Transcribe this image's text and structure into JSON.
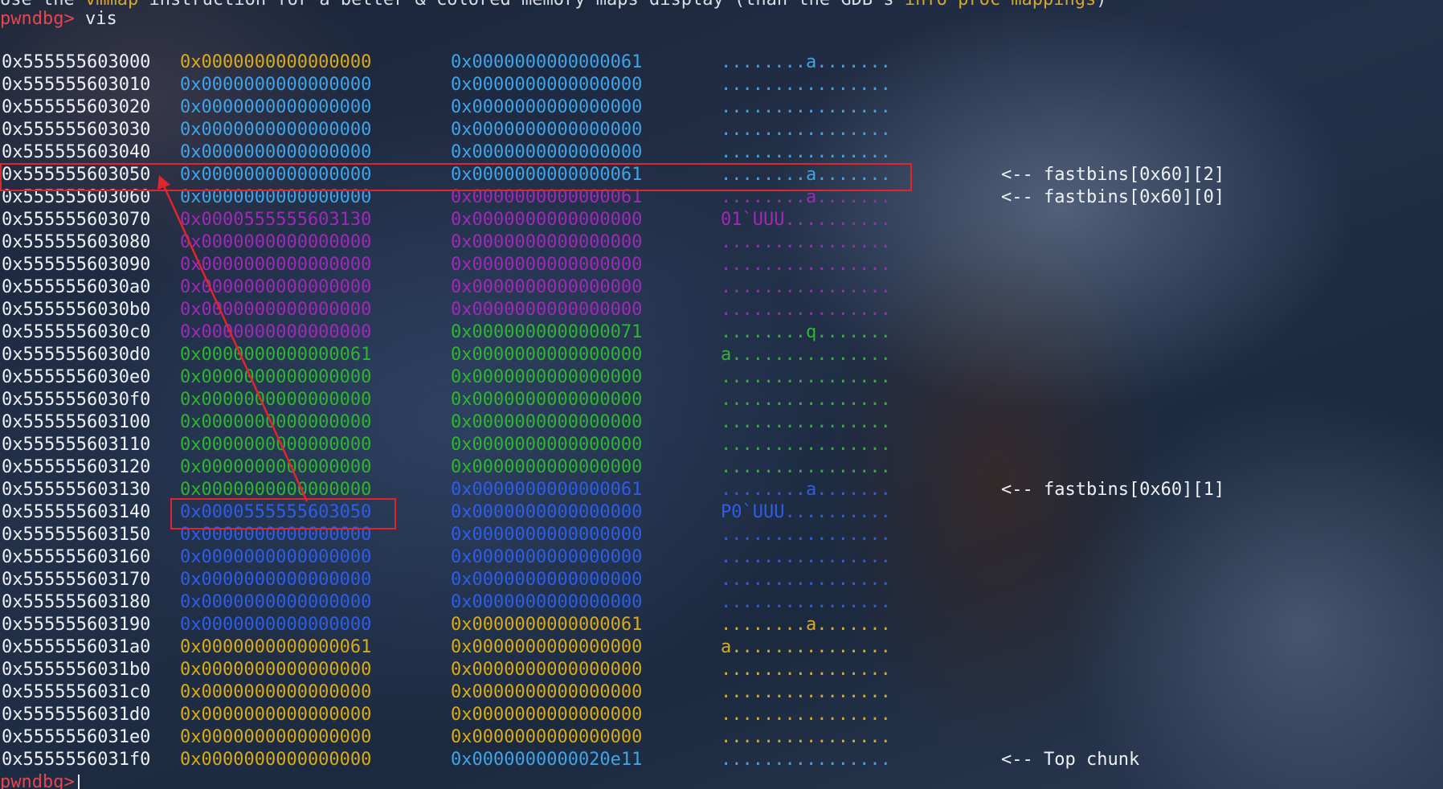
{
  "terminal": {
    "previous_line": {
      "prefix": "Use the ",
      "cmd1": "vmmap",
      "middle": " instruction for a better & colored memory maps display (than the GDB's ",
      "cmd2": "info proc mappings",
      "suffix": ")"
    },
    "prompt": "pwndbg>",
    "command": "vis",
    "colors": {
      "prompt": "#e8454f",
      "yellow": "#d9ab17",
      "lightblue": "#3fa4e8",
      "purple": "#9f2ab8",
      "green": "#2fb52f",
      "blue": "#2e5ee8",
      "highlight_box": "#e0252d"
    },
    "rows": [
      {
        "addr": "0x555555603000",
        "v1": "0x0000000000000000",
        "c1": "yellow",
        "v2": "0x0000000000000061",
        "c2": "lightblue",
        "ascii": "........a.......",
        "c3": "lightblue",
        "note": ""
      },
      {
        "addr": "0x555555603010",
        "v1": "0x0000000000000000",
        "c1": "lightblue",
        "v2": "0x0000000000000000",
        "c2": "lightblue",
        "ascii": "................",
        "c3": "lightblue",
        "note": ""
      },
      {
        "addr": "0x555555603020",
        "v1": "0x0000000000000000",
        "c1": "lightblue",
        "v2": "0x0000000000000000",
        "c2": "lightblue",
        "ascii": "................",
        "c3": "lightblue",
        "note": ""
      },
      {
        "addr": "0x555555603030",
        "v1": "0x0000000000000000",
        "c1": "lightblue",
        "v2": "0x0000000000000000",
        "c2": "lightblue",
        "ascii": "................",
        "c3": "lightblue",
        "note": ""
      },
      {
        "addr": "0x555555603040",
        "v1": "0x0000000000000000",
        "c1": "lightblue",
        "v2": "0x0000000000000000",
        "c2": "lightblue",
        "ascii": "................",
        "c3": "lightblue",
        "note": ""
      },
      {
        "addr": "0x555555603050",
        "v1": "0x0000000000000000",
        "c1": "lightblue",
        "v2": "0x0000000000000061",
        "c2": "lightblue",
        "ascii": "........a.......",
        "c3": "lightblue",
        "note": "<-- fastbins[0x60][2]"
      },
      {
        "addr": "0x555555603060",
        "v1": "0x0000000000000000",
        "c1": "lightblue",
        "v2": "0x0000000000000061",
        "c2": "purple",
        "ascii": "........a.......",
        "c3": "purple",
        "note": "<-- fastbins[0x60][0]"
      },
      {
        "addr": "0x555555603070",
        "v1": "0x0000555555603130",
        "c1": "purple",
        "v2": "0x0000000000000000",
        "c2": "purple",
        "ascii": "01`UUU..........",
        "c3": "purple",
        "note": ""
      },
      {
        "addr": "0x555555603080",
        "v1": "0x0000000000000000",
        "c1": "purple",
        "v2": "0x0000000000000000",
        "c2": "purple",
        "ascii": "................",
        "c3": "purple",
        "note": ""
      },
      {
        "addr": "0x555555603090",
        "v1": "0x0000000000000000",
        "c1": "purple",
        "v2": "0x0000000000000000",
        "c2": "purple",
        "ascii": "................",
        "c3": "purple",
        "note": ""
      },
      {
        "addr": "0x5555556030a0",
        "v1": "0x0000000000000000",
        "c1": "purple",
        "v2": "0x0000000000000000",
        "c2": "purple",
        "ascii": "................",
        "c3": "purple",
        "note": ""
      },
      {
        "addr": "0x5555556030b0",
        "v1": "0x0000000000000000",
        "c1": "purple",
        "v2": "0x0000000000000000",
        "c2": "purple",
        "ascii": "................",
        "c3": "purple",
        "note": ""
      },
      {
        "addr": "0x5555556030c0",
        "v1": "0x0000000000000000",
        "c1": "purple",
        "v2": "0x0000000000000071",
        "c2": "green",
        "ascii": "........q.......",
        "c3": "green",
        "note": ""
      },
      {
        "addr": "0x5555556030d0",
        "v1": "0x0000000000000061",
        "c1": "green",
        "v2": "0x0000000000000000",
        "c2": "green",
        "ascii": "a...............",
        "c3": "green",
        "note": ""
      },
      {
        "addr": "0x5555556030e0",
        "v1": "0x0000000000000000",
        "c1": "green",
        "v2": "0x0000000000000000",
        "c2": "green",
        "ascii": "................",
        "c3": "green",
        "note": ""
      },
      {
        "addr": "0x5555556030f0",
        "v1": "0x0000000000000000",
        "c1": "green",
        "v2": "0x0000000000000000",
        "c2": "green",
        "ascii": "................",
        "c3": "green",
        "note": ""
      },
      {
        "addr": "0x555555603100",
        "v1": "0x0000000000000000",
        "c1": "green",
        "v2": "0x0000000000000000",
        "c2": "green",
        "ascii": "................",
        "c3": "green",
        "note": ""
      },
      {
        "addr": "0x555555603110",
        "v1": "0x0000000000000000",
        "c1": "green",
        "v2": "0x0000000000000000",
        "c2": "green",
        "ascii": "................",
        "c3": "green",
        "note": ""
      },
      {
        "addr": "0x555555603120",
        "v1": "0x0000000000000000",
        "c1": "green",
        "v2": "0x0000000000000000",
        "c2": "green",
        "ascii": "................",
        "c3": "green",
        "note": ""
      },
      {
        "addr": "0x555555603130",
        "v1": "0x0000000000000000",
        "c1": "green",
        "v2": "0x0000000000000061",
        "c2": "blue",
        "ascii": "........a.......",
        "c3": "blue",
        "note": "<-- fastbins[0x60][1]"
      },
      {
        "addr": "0x555555603140",
        "v1": "0x0000555555603050",
        "c1": "blue",
        "v2": "0x0000000000000000",
        "c2": "blue",
        "ascii": "P0`UUU..........",
        "c3": "blue",
        "note": ""
      },
      {
        "addr": "0x555555603150",
        "v1": "0x0000000000000000",
        "c1": "blue",
        "v2": "0x0000000000000000",
        "c2": "blue",
        "ascii": "................",
        "c3": "blue",
        "note": ""
      },
      {
        "addr": "0x555555603160",
        "v1": "0x0000000000000000",
        "c1": "blue",
        "v2": "0x0000000000000000",
        "c2": "blue",
        "ascii": "................",
        "c3": "blue",
        "note": ""
      },
      {
        "addr": "0x555555603170",
        "v1": "0x0000000000000000",
        "c1": "blue",
        "v2": "0x0000000000000000",
        "c2": "blue",
        "ascii": "................",
        "c3": "blue",
        "note": ""
      },
      {
        "addr": "0x555555603180",
        "v1": "0x0000000000000000",
        "c1": "blue",
        "v2": "0x0000000000000000",
        "c2": "blue",
        "ascii": "................",
        "c3": "blue",
        "note": ""
      },
      {
        "addr": "0x555555603190",
        "v1": "0x0000000000000000",
        "c1": "blue",
        "v2": "0x0000000000000061",
        "c2": "yellow",
        "ascii": "........a.......",
        "c3": "yellow",
        "note": ""
      },
      {
        "addr": "0x5555556031a0",
        "v1": "0x0000000000000061",
        "c1": "yellow",
        "v2": "0x0000000000000000",
        "c2": "yellow",
        "ascii": "a...............",
        "c3": "yellow",
        "note": ""
      },
      {
        "addr": "0x5555556031b0",
        "v1": "0x0000000000000000",
        "c1": "yellow",
        "v2": "0x0000000000000000",
        "c2": "yellow",
        "ascii": "................",
        "c3": "yellow",
        "note": ""
      },
      {
        "addr": "0x5555556031c0",
        "v1": "0x0000000000000000",
        "c1": "yellow",
        "v2": "0x0000000000000000",
        "c2": "yellow",
        "ascii": "................",
        "c3": "yellow",
        "note": ""
      },
      {
        "addr": "0x5555556031d0",
        "v1": "0x0000000000000000",
        "c1": "yellow",
        "v2": "0x0000000000000000",
        "c2": "yellow",
        "ascii": "................",
        "c3": "yellow",
        "note": ""
      },
      {
        "addr": "0x5555556031e0",
        "v1": "0x0000000000000000",
        "c1": "yellow",
        "v2": "0x0000000000000000",
        "c2": "yellow",
        "ascii": "................",
        "c3": "yellow",
        "note": ""
      },
      {
        "addr": "0x5555556031f0",
        "v1": "0x0000000000000000",
        "c1": "yellow",
        "v2": "0x0000000000020e11",
        "c2": "lightblue",
        "ascii": "................",
        "c3": "lightblue",
        "note": "<-- Top chunk"
      }
    ]
  }
}
